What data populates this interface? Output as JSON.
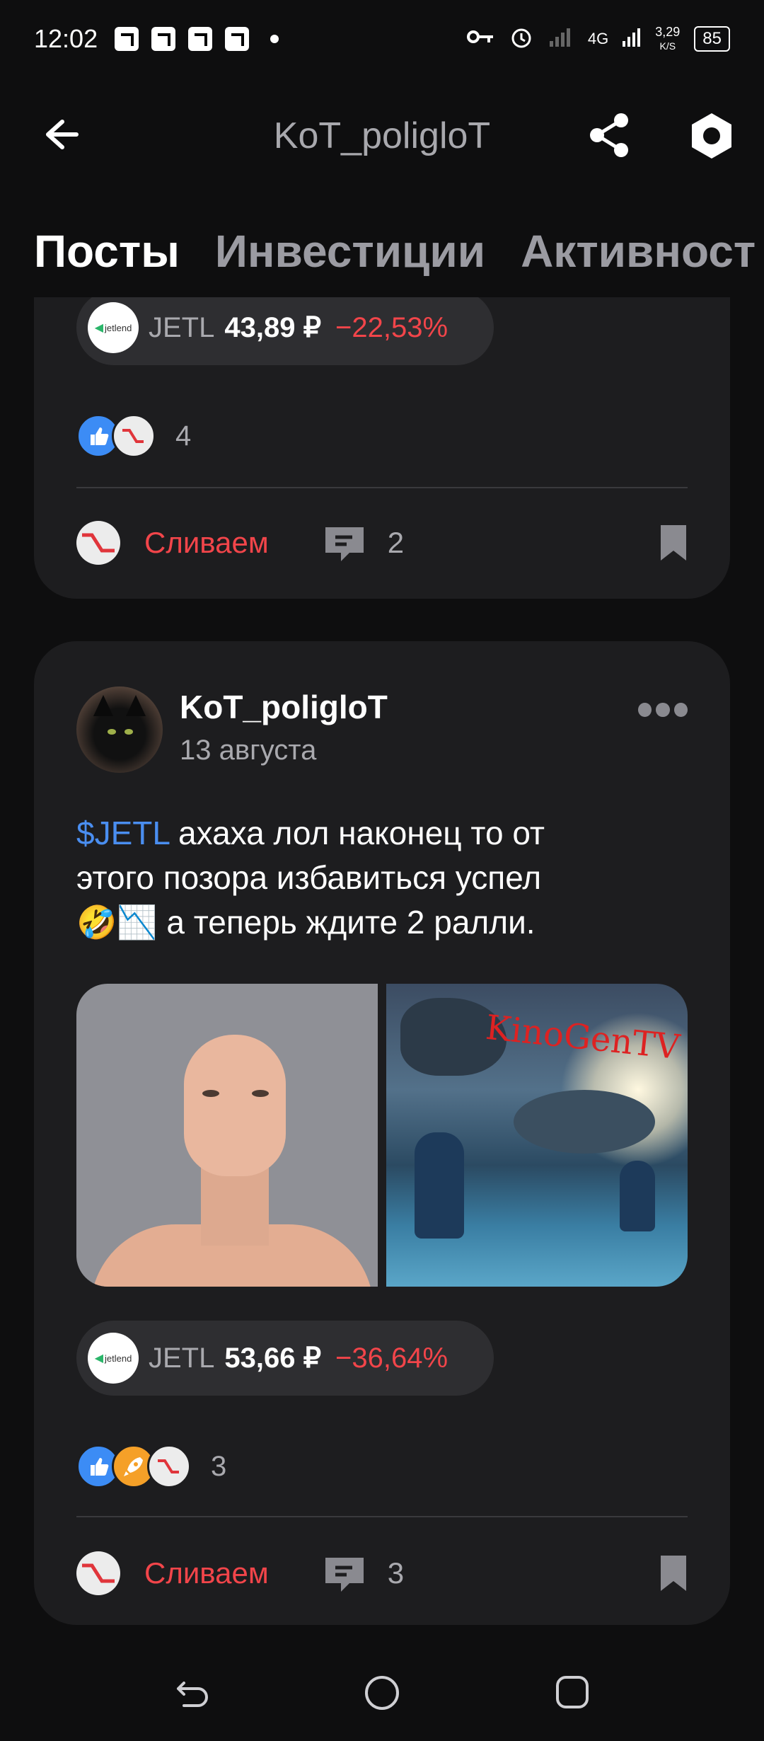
{
  "status_bar": {
    "time": "12:02",
    "network": "4G",
    "speed": "3,29",
    "speed_unit": "K/S",
    "battery": "85"
  },
  "header": {
    "title": "KoT_poliglоT"
  },
  "tabs": [
    {
      "label": "Посты",
      "active": true
    },
    {
      "label": "Инвестиции",
      "active": false
    },
    {
      "label": "Активност",
      "active": false
    }
  ],
  "prev_post": {
    "ticker": {
      "logo_text": "jetlend",
      "symbol": "JETL",
      "price": "43,89 ₽",
      "change": "−22,53%"
    },
    "reaction_count": "4",
    "dump_label": "Сливаем",
    "comment_count": "2"
  },
  "post": {
    "author": "KoT_poliglоT",
    "date": "13 августа",
    "text_tag": "$JETL",
    "text_line1_rest": " ахаха лол наконец то от",
    "text_line2": "этого позора избавиться успел",
    "text_line3_emoji": "🤣📉",
    "text_line3_rest": " а теперь ждите 2 ралли.",
    "image_watermark": "KinoGenTV",
    "ticker": {
      "logo_text": "jetlend",
      "symbol": "JETL",
      "price": "53,66 ₽",
      "change": "−36,64%"
    },
    "reaction_count": "3",
    "dump_label": "Сливаем",
    "comment_count": "3"
  },
  "colors": {
    "background": "#0e0e0f",
    "card": "#1d1d1f",
    "accent_red": "#f2454a",
    "tag_blue": "#4a8ef0"
  }
}
